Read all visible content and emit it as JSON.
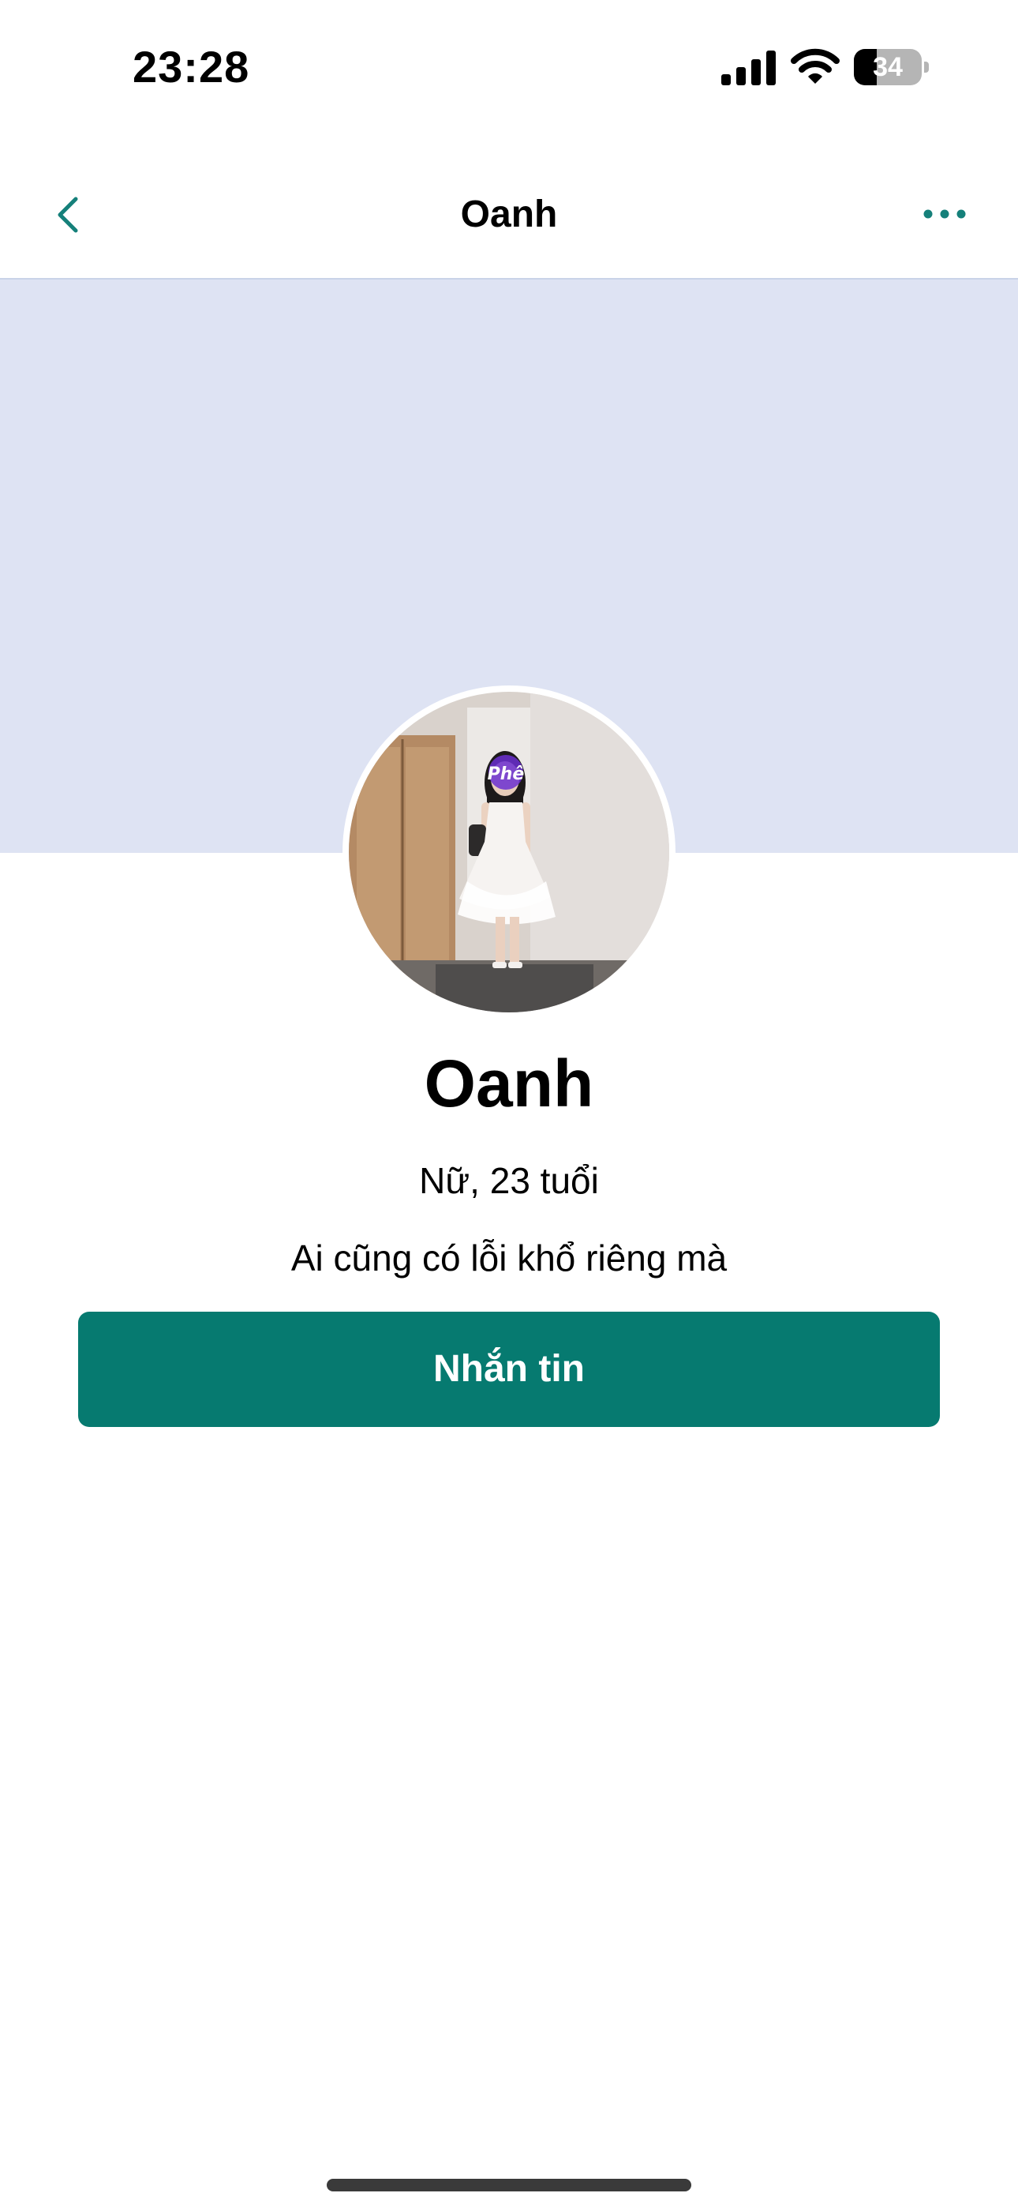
{
  "status_bar": {
    "time": "23:28",
    "battery_level": "34",
    "battery_fraction": 0.34,
    "icons": [
      "signal-icon",
      "wifi-icon",
      "battery-icon"
    ]
  },
  "nav": {
    "title": "Oanh",
    "back_icon": "chevron-left-icon",
    "more_icon": "ellipsis-icon"
  },
  "profile": {
    "name": "Oanh",
    "meta": "Nữ, 23 tuổi",
    "bio": "Ai cũng có lỗi khổ riêng mà",
    "avatar_sticker": "Phê"
  },
  "actions": {
    "message_label": "Nhắn tin"
  },
  "colors": {
    "accent": "#067a70",
    "cover": "#dee3f3",
    "nav_icon": "#15807a"
  }
}
